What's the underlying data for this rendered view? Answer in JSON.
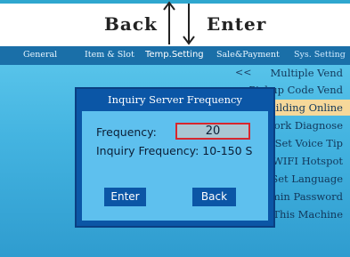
{
  "nav": {
    "back_label": "Back",
    "enter_label": "Enter"
  },
  "tabs": [
    {
      "label": "General"
    },
    {
      "label": "Item & Slot"
    },
    {
      "label": "Temp.Setting"
    },
    {
      "label": "Sale&Payment"
    },
    {
      "label": "Sys. Setting"
    }
  ],
  "menu": {
    "back_marker": "<<",
    "items": [
      {
        "label": "Multiple Vend"
      },
      {
        "label": "Pickup Code Vend"
      },
      {
        "label": "Building Online",
        "selected": true
      },
      {
        "label": "Network Diagnose"
      },
      {
        "label": "Set Voice Tip"
      },
      {
        "label": "WIFI Hotspot"
      },
      {
        "label": "Set Language"
      },
      {
        "label": "Admin Password"
      },
      {
        "label": "This Machine"
      }
    ]
  },
  "dialog": {
    "title": "Inquiry Server Frequency",
    "frequency_label": "Frequency:",
    "frequency_value": "20",
    "range_text": "Inquiry Frequency: 10-150 S",
    "enter_label": "Enter",
    "back_label": "Back"
  },
  "colors": {
    "accent_border": "#d8262d",
    "dialog_blue": "#0b56a6",
    "selected_row": "#f6d89a"
  }
}
